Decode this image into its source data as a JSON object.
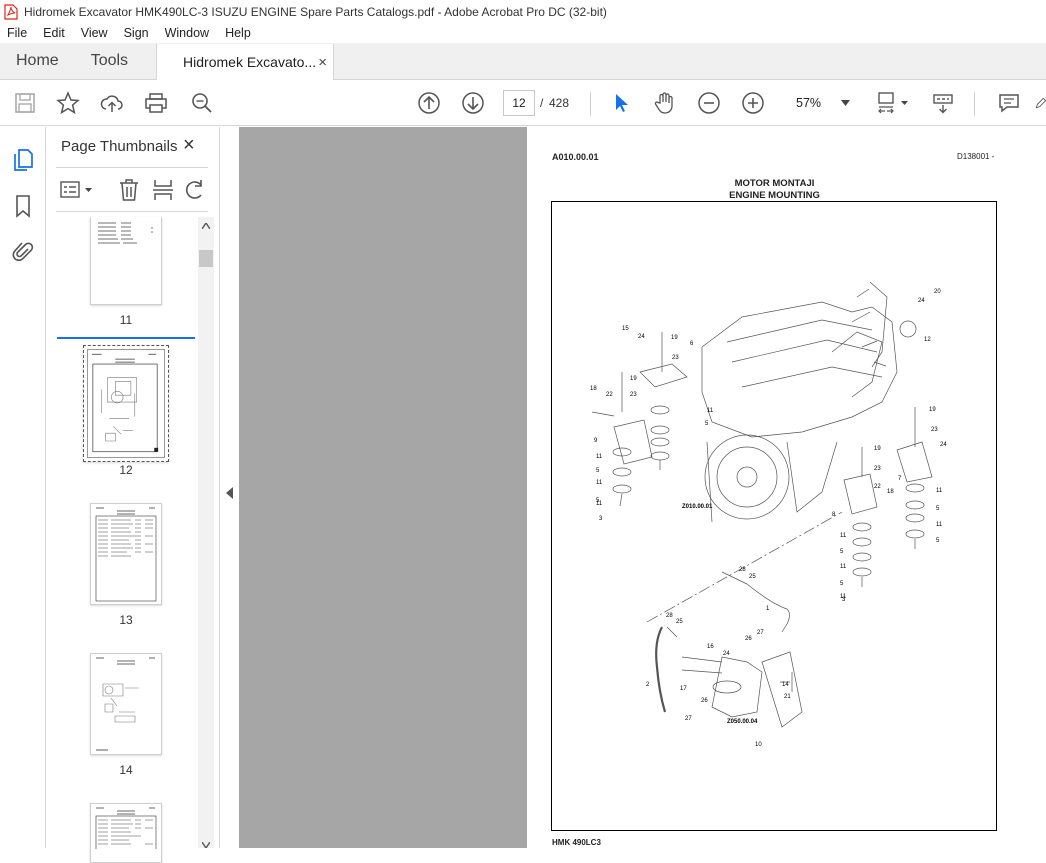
{
  "window": {
    "title": "Hidromek Excavator HMK490LC-3 ISUZU ENGINE Spare Parts Catalogs.pdf - Adobe Acrobat Pro DC (32-bit)"
  },
  "menu": [
    "File",
    "Edit",
    "View",
    "Sign",
    "Window",
    "Help"
  ],
  "tabs": {
    "home": "Home",
    "tools": "Tools",
    "document": "Hidromek Excavato...",
    "close": "×"
  },
  "toolbar": {
    "current_page": "12",
    "separator": "/",
    "total_pages": "428",
    "zoom": "57%",
    "icons": [
      "save-icon",
      "star-icon",
      "upload-icon",
      "print-icon",
      "zoom-search-icon",
      "page-up-icon",
      "page-down-icon",
      "select-arrow-icon",
      "hand-icon",
      "zoom-out-icon",
      "zoom-in-icon",
      "page-fit-icon",
      "scroll-mode-icon",
      "comment-icon",
      "pen-icon"
    ]
  },
  "sidebar": {
    "title": "Page Thumbnails",
    "close": "×",
    "thumbnails": [
      {
        "label": "11",
        "selected": false
      },
      {
        "label": "12",
        "selected": true
      },
      {
        "label": "13",
        "selected": false
      },
      {
        "label": "14",
        "selected": false
      },
      {
        "label": "",
        "selected": false
      }
    ]
  },
  "document_page": {
    "code": "A010.00.01",
    "ref": "D138001 -",
    "title_tr": "MOTOR MONTAJI",
    "title_en": "ENGINE MOUNTING",
    "footer": "HMK 490LC3",
    "callouts": [
      "20",
      "24",
      "12",
      "15",
      "24",
      "19",
      "6",
      "23",
      "18",
      "22",
      "19",
      "23",
      "11",
      "5",
      "9",
      "11",
      "5",
      "11",
      "5",
      "11",
      "3",
      "19",
      "23",
      "24",
      "7",
      "11",
      "5",
      "11",
      "5",
      "19",
      "23",
      "22",
      "18",
      "8",
      "11",
      "5",
      "11",
      "5",
      "11",
      "3",
      "Z010.00.01",
      "28",
      "25",
      "1",
      "28",
      "25",
      "26",
      "27",
      "16",
      "24",
      "2",
      "17",
      "14",
      "21",
      "26",
      "27",
      "Z050.00.04",
      "10"
    ]
  },
  "colors": {
    "accent": "#1473e6",
    "acrobat_red": "#e2231a",
    "canvas_grey": "#a6a6a6"
  }
}
